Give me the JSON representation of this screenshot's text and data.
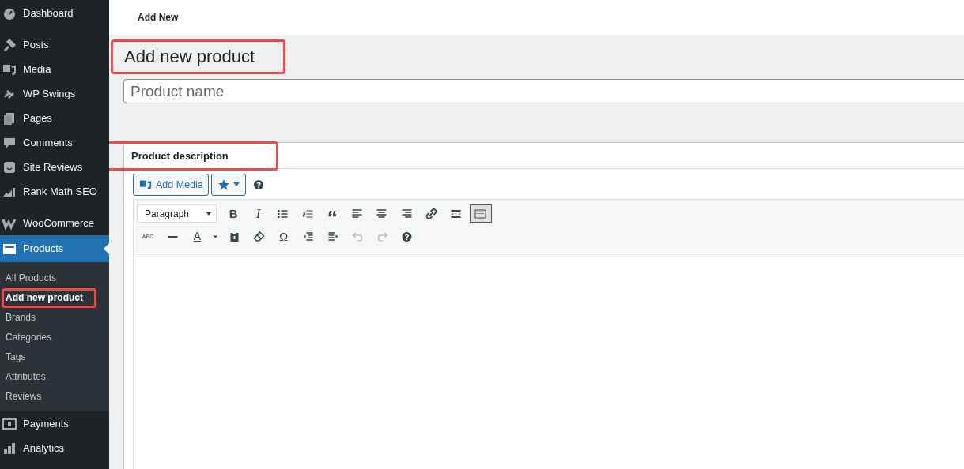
{
  "sidebar": {
    "groups": [
      [
        {
          "label": "Dashboard"
        }
      ],
      [
        {
          "label": "Posts"
        },
        {
          "label": "Media"
        },
        {
          "label": "WP Swings"
        },
        {
          "label": "Pages"
        },
        {
          "label": "Comments"
        },
        {
          "label": "Site Reviews"
        },
        {
          "label": "Rank Math SEO"
        }
      ],
      [
        {
          "label": "WooCommerce"
        },
        {
          "label": "Products",
          "selected": true,
          "submenu": [
            {
              "label": "All Products",
              "selected": false,
              "highlighted": false
            },
            {
              "label": "Add new product",
              "selected": true,
              "highlighted": true
            },
            {
              "label": "Brands",
              "selected": false,
              "highlighted": false
            },
            {
              "label": "Categories",
              "selected": false,
              "highlighted": false
            },
            {
              "label": "Tags",
              "selected": false,
              "highlighted": false
            },
            {
              "label": "Attributes",
              "selected": false,
              "highlighted": false
            },
            {
              "label": "Reviews",
              "selected": false,
              "highlighted": false
            }
          ]
        },
        {
          "label": "Payments"
        },
        {
          "label": "Analytics"
        }
      ]
    ]
  },
  "top_bar": {
    "title": "Add New"
  },
  "page": {
    "title": "Add new product",
    "title_highlighted": true,
    "name_field": {
      "placeholder": "Product name"
    },
    "description": {
      "title": "Product description",
      "title_highlighted": true,
      "add_media": "Add Media",
      "row1": [
        {
          "kind": "select",
          "label": "Paragraph"
        },
        {
          "kind": "text",
          "label": "B",
          "disabled": false,
          "pressed": false
        },
        {
          "kind": "text",
          "label": "I",
          "disabled": false,
          "pressed": false
        },
        {
          "kind": "icon",
          "disabled": false,
          "pressed": false
        },
        {
          "kind": "icon",
          "disabled": false,
          "pressed": false
        },
        {
          "kind": "text",
          "label": "“",
          "disabled": false,
          "pressed": false
        },
        {
          "kind": "icon",
          "disabled": false,
          "pressed": false
        },
        {
          "kind": "icon",
          "disabled": false,
          "pressed": false
        },
        {
          "kind": "icon",
          "disabled": false,
          "pressed": false
        },
        {
          "kind": "icon",
          "disabled": false,
          "pressed": false
        },
        {
          "kind": "icon",
          "disabled": false,
          "pressed": false
        },
        {
          "kind": "icon",
          "disabled": false,
          "pressed": true
        }
      ],
      "row2": [
        {
          "kind": "text",
          "label": "ABC",
          "disabled": false,
          "pressed": false
        },
        {
          "kind": "icon",
          "disabled": false,
          "pressed": false
        },
        {
          "kind": "text",
          "label": "A",
          "disabled": false,
          "pressed": false
        },
        {
          "kind": "icon",
          "disabled": false,
          "pressed": false
        },
        {
          "kind": "icon",
          "disabled": false,
          "pressed": false
        },
        {
          "kind": "icon",
          "disabled": false,
          "pressed": false
        },
        {
          "kind": "text",
          "label": "Ω",
          "disabled": false,
          "pressed": false
        },
        {
          "kind": "icon",
          "disabled": false,
          "pressed": false
        },
        {
          "kind": "icon",
          "disabled": false,
          "pressed": false
        },
        {
          "kind": "icon",
          "disabled": true,
          "pressed": false
        },
        {
          "kind": "icon",
          "disabled": true,
          "pressed": false
        },
        {
          "kind": "icon",
          "disabled": false,
          "pressed": false
        }
      ]
    }
  }
}
